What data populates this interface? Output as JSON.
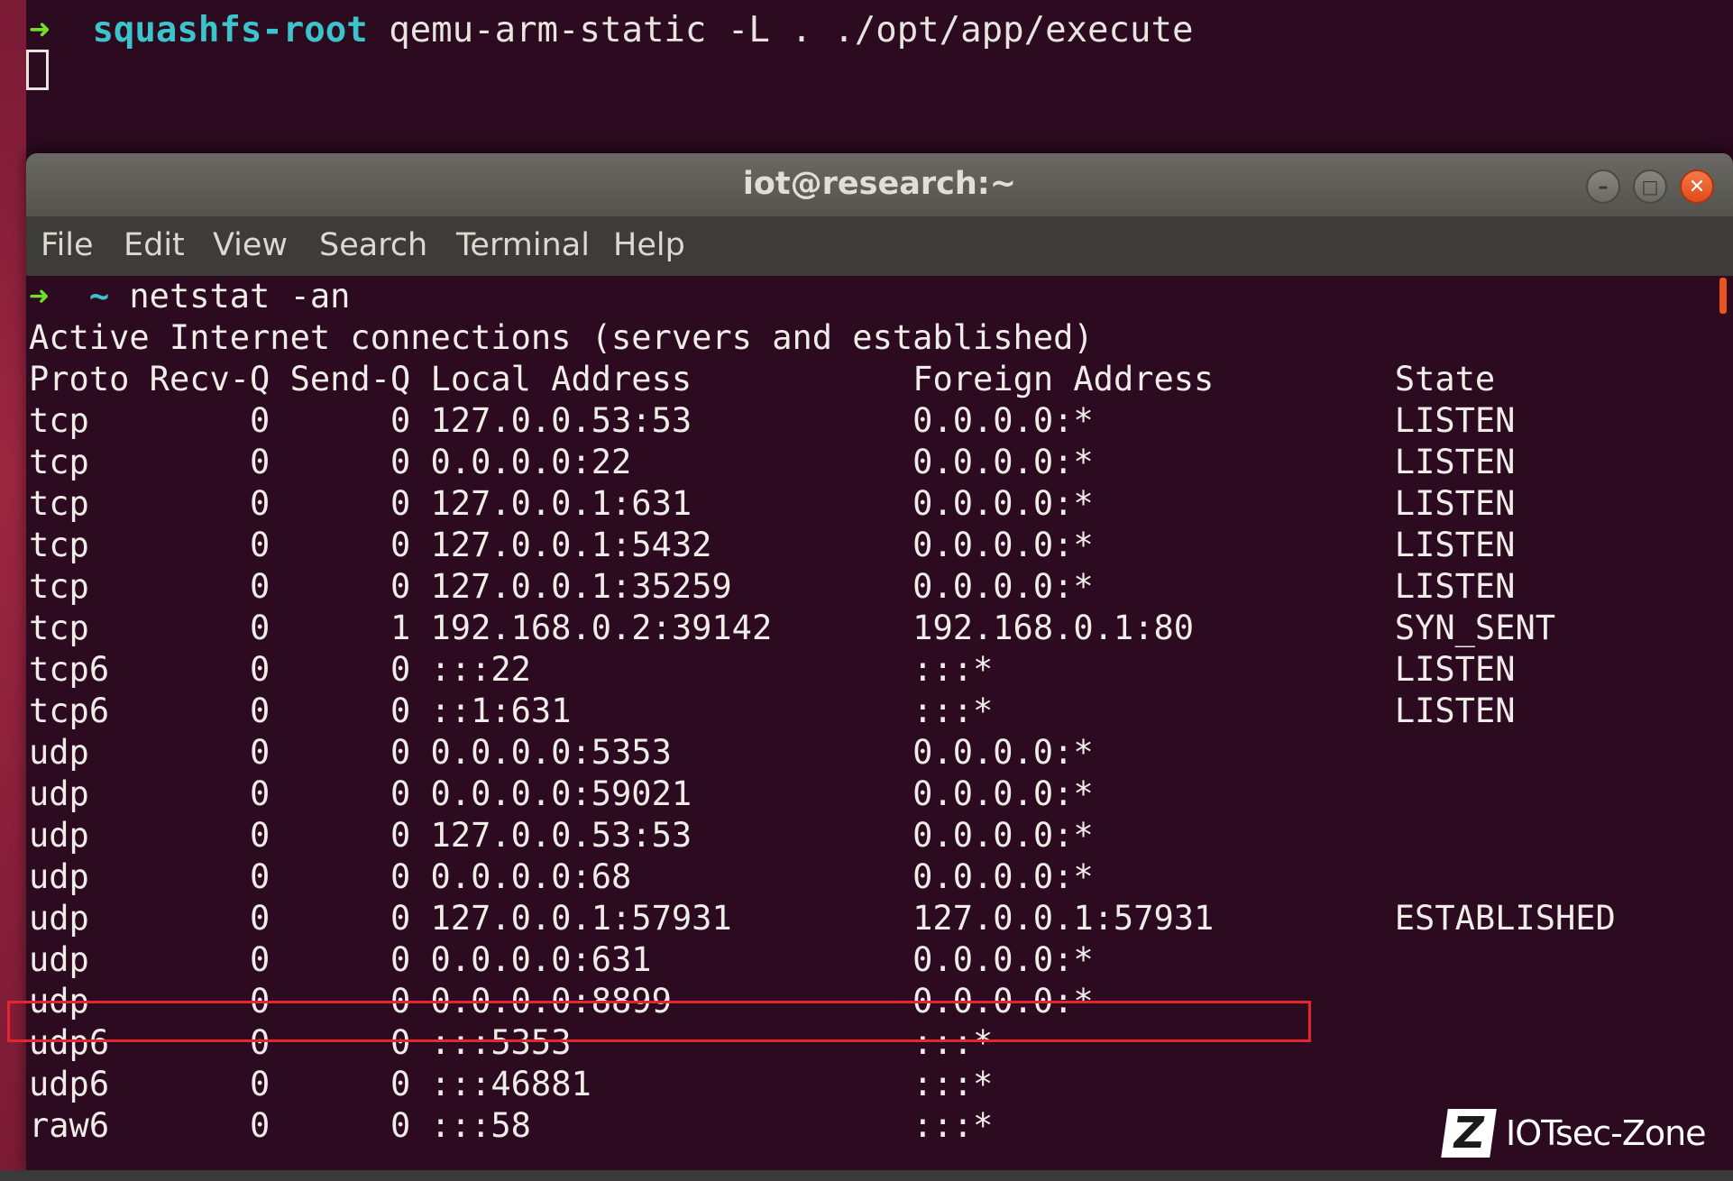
{
  "background_terminal": {
    "prompt_arrow": "➜",
    "directory": "squashfs-root",
    "command": "qemu-arm-static -L . ./opt/app/execute"
  },
  "window": {
    "title": "iot@research:~",
    "buttons": {
      "minimize": "–",
      "maximize": "□",
      "close": "✕"
    }
  },
  "menu": [
    "File",
    "Edit",
    "View",
    "Search",
    "Terminal",
    "Help"
  ],
  "terminal": {
    "prompt_arrow": "➜",
    "prompt_dir": "~",
    "command": "netstat -an",
    "heading": "Active Internet connections (servers and established)",
    "columns": [
      "Proto",
      "Recv-Q",
      "Send-Q",
      "Local Address",
      "Foreign Address",
      "State"
    ],
    "rows": [
      [
        "tcp",
        "0",
        "0",
        "127.0.0.53:53",
        "0.0.0.0:*",
        "LISTEN"
      ],
      [
        "tcp",
        "0",
        "0",
        "0.0.0.0:22",
        "0.0.0.0:*",
        "LISTEN"
      ],
      [
        "tcp",
        "0",
        "0",
        "127.0.0.1:631",
        "0.0.0.0:*",
        "LISTEN"
      ],
      [
        "tcp",
        "0",
        "0",
        "127.0.0.1:5432",
        "0.0.0.0:*",
        "LISTEN"
      ],
      [
        "tcp",
        "0",
        "0",
        "127.0.0.1:35259",
        "0.0.0.0:*",
        "LISTEN"
      ],
      [
        "tcp",
        "0",
        "1",
        "192.168.0.2:39142",
        "192.168.0.1:80",
        "SYN_SENT"
      ],
      [
        "tcp6",
        "0",
        "0",
        ":::22",
        ":::*",
        "LISTEN"
      ],
      [
        "tcp6",
        "0",
        "0",
        "::1:631",
        ":::*",
        "LISTEN"
      ],
      [
        "udp",
        "0",
        "0",
        "0.0.0.0:5353",
        "0.0.0.0:*",
        ""
      ],
      [
        "udp",
        "0",
        "0",
        "0.0.0.0:59021",
        "0.0.0.0:*",
        ""
      ],
      [
        "udp",
        "0",
        "0",
        "127.0.0.53:53",
        "0.0.0.0:*",
        ""
      ],
      [
        "udp",
        "0",
        "0",
        "0.0.0.0:68",
        "0.0.0.0:*",
        ""
      ],
      [
        "udp",
        "0",
        "0",
        "127.0.0.1:57931",
        "127.0.0.1:57931",
        "ESTABLISHED"
      ],
      [
        "udp",
        "0",
        "0",
        "0.0.0.0:631",
        "0.0.0.0:*",
        ""
      ],
      [
        "udp",
        "0",
        "0",
        "0.0.0.0:8899",
        "0.0.0.0:*",
        ""
      ],
      [
        "udp6",
        "0",
        "0",
        ":::5353",
        ":::*",
        ""
      ],
      [
        "udp6",
        "0",
        "0",
        ":::46881",
        ":::*",
        ""
      ],
      [
        "raw6",
        "0",
        "0",
        ":::58",
        ":::*",
        ""
      ]
    ],
    "highlighted_row": 14
  },
  "watermark": {
    "logo_letter": "Z",
    "text": "IOTsec-Zone"
  },
  "colors": {
    "terminal_bg": "#2c0a1f",
    "prompt_arrow": "#6fe02a",
    "directory": "#3bc4cc",
    "highlight_box": "#e5262f",
    "close_button": "#e95420"
  }
}
